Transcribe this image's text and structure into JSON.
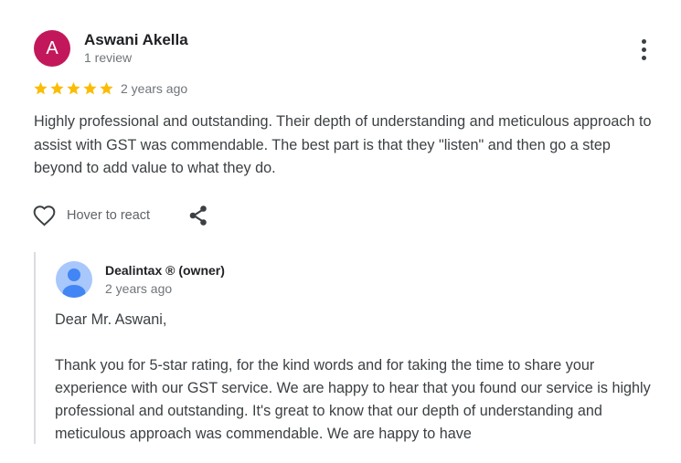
{
  "review": {
    "avatar_letter": "A",
    "avatar_color": "#c2185b",
    "reviewer_name": "Aswani Akella",
    "review_count": "1 review",
    "rating": 5,
    "rating_max": 5,
    "star_color": "#fbbc04",
    "date": "2 years ago",
    "text": "Highly professional and outstanding. Their depth of understanding and meticulous approach to assist with GST was commendable. The best part is that they \"listen\" and then go a step beyond to add value to what they do.",
    "react_label": "Hover to react",
    "more_icon": "more-vert-icon",
    "react_icon": "heart-outline-icon",
    "share_icon": "share-icon"
  },
  "owner_reply": {
    "name": "Dealintax ® (owner)",
    "date": "2 years ago",
    "avatar_icon": "person-icon",
    "greeting": "Dear Mr. Aswani,",
    "body": "Thank you for 5-star rating, for the kind words and for taking the time to share your experience with our GST service. We are happy to hear that you found our service is highly professional and outstanding. It's great to know that our depth of understanding and meticulous approach was commendable. We are happy to have"
  }
}
